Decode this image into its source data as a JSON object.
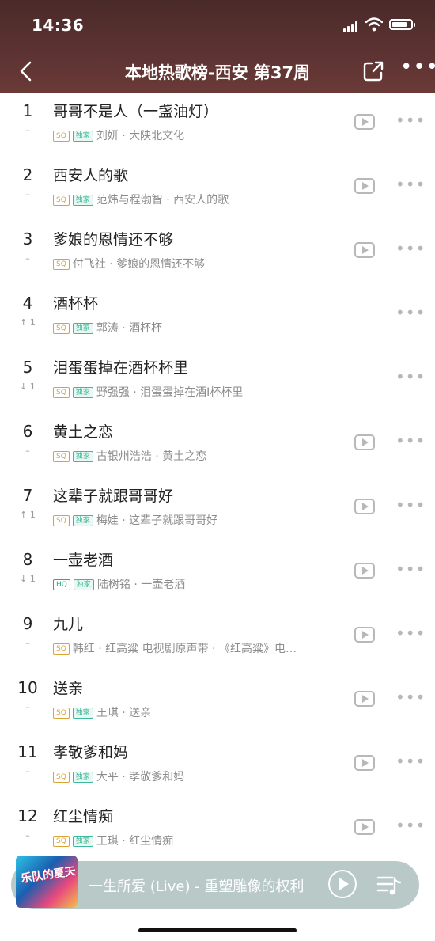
{
  "status_bar": {
    "time": "14:36"
  },
  "header": {
    "title": "本地热歌榜-西安 第37周"
  },
  "songs": [
    {
      "rank": "1",
      "change": "–",
      "title": "哥哥不是人（一盏油灯）",
      "tags": [
        "SQ",
        "独家"
      ],
      "artist": "刘妍",
      "album": "大陕北文化"
    },
    {
      "rank": "2",
      "change": "–",
      "title": "西安人的歌",
      "tags": [
        "SQ",
        "独家"
      ],
      "artist": "范炜与程渤智",
      "album": "西安人的歌"
    },
    {
      "rank": "3",
      "change": "–",
      "title": "爹娘的恩情还不够",
      "tags": [
        "SQ"
      ],
      "artist": "付飞社",
      "album": "爹娘的恩情还不够"
    },
    {
      "rank": "4",
      "change": "↑ 1",
      "title": "酒杯杯",
      "tags": [
        "SQ",
        "独家"
      ],
      "artist": "郭涛",
      "album": "酒杯杯"
    },
    {
      "rank": "5",
      "change": "↓ 1",
      "title": "泪蛋蛋掉在酒杯杯里",
      "tags": [
        "SQ",
        "独家"
      ],
      "artist": "野强强",
      "album": "泪蛋蛋掉在酒I杯杯里"
    },
    {
      "rank": "6",
      "change": "–",
      "title": "黄土之恋",
      "tags": [
        "SQ",
        "独家"
      ],
      "artist": "古银州浩浩",
      "album": "黄土之恋"
    },
    {
      "rank": "7",
      "change": "↑ 1",
      "title": "这辈子就跟哥哥好",
      "tags": [
        "SQ",
        "独家"
      ],
      "artist": "梅娃",
      "album": "这辈子就跟哥哥好"
    },
    {
      "rank": "8",
      "change": "↓ 1",
      "title": "一壶老酒",
      "tags": [
        "HQ",
        "独家"
      ],
      "artist": "陆树铭",
      "album": "一壶老酒"
    },
    {
      "rank": "9",
      "change": "–",
      "title": "九儿",
      "tags": [
        "SQ"
      ],
      "artist": "韩红",
      "album": "红高粱 电视剧原声带 · 《红高粱》电…"
    },
    {
      "rank": "10",
      "change": "–",
      "title": "送亲",
      "tags": [
        "SQ",
        "独家"
      ],
      "artist": "王琪",
      "album": "送亲"
    },
    {
      "rank": "11",
      "change": "–",
      "title": "孝敬爹和妈",
      "tags": [
        "SQ",
        "独家"
      ],
      "artist": "大平",
      "album": "孝敬爹和妈"
    },
    {
      "rank": "12",
      "change": "–",
      "title": "红尘情痴",
      "tags": [
        "SQ",
        "独家"
      ],
      "artist": "王琪",
      "album": "红尘情痴"
    }
  ],
  "separator": " · ",
  "now_playing": {
    "text": "一生所爱 (Live) - 重塑雕像的权利",
    "cover_text": "乐队的夏天"
  },
  "colors": {
    "header_bg": "#5a3331",
    "sq": "#d9a33a",
    "exclusive": "#3db89a",
    "player_bg": "#b9c9c8"
  }
}
